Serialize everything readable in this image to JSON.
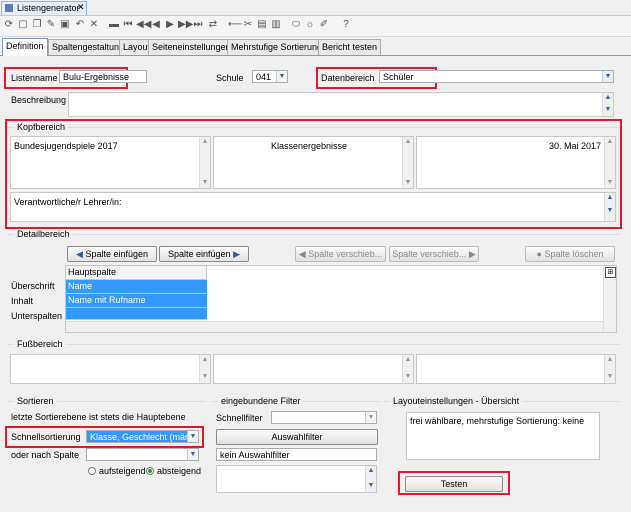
{
  "window": {
    "title": "Listengenerator"
  },
  "tabs": [
    {
      "label": "Definition"
    },
    {
      "label": "Spaltengestaltung"
    },
    {
      "label": "Layout"
    },
    {
      "label": "Seiteneinstellungen"
    },
    {
      "label": "Mehrstufige Sortierung"
    },
    {
      "label": "Bericht testen"
    }
  ],
  "header": {
    "listenname_label": "Listenname",
    "listenname_value": "Bulu-Ergebnisse",
    "schule_label": "Schule",
    "schule_value": "041",
    "datenbereich_label": "Datenbereich",
    "datenbereich_value": "Schüler",
    "beschreibung_label": "Beschreibung"
  },
  "kopfbereich": {
    "title": "Kopfbereich",
    "left": "Bundesjugendspiele 2017",
    "center": "Klassenergebnisse",
    "right": "30. Mai 2017",
    "bottom": "Verantwortliche/r Lehrer/in:"
  },
  "detailbereich": {
    "title": "Detailbereich",
    "btn_insert_left": "Spalte einfügen",
    "btn_insert_right": "Spalte einfügen",
    "btn_move_left": "Spalte verschieb...",
    "btn_move_right": "Spalte verschieb...",
    "btn_delete": "Spalte löschen",
    "row_labels": [
      "Überschrift",
      "Inhalt",
      "Unterspalten"
    ],
    "column_header": "Hauptspalte",
    "rows": [
      "Name",
      "Name mit Rufname"
    ]
  },
  "fussbereich": {
    "title": "Fußbereich"
  },
  "sortieren": {
    "title": "Sortieren",
    "note": "letzte Sortierebene ist stets die Hauptebene",
    "schnell_label": "Schnellsortierung",
    "schnell_value": "Klasse, Geschlecht (männlic",
    "oder_label": "oder nach Spalte",
    "oder_value": "",
    "asc_label": "aufsteigend",
    "desc_label": "absteigend"
  },
  "filter": {
    "title": "eingebundene Filter",
    "schnellfilter_label": "Schnellfilter",
    "schnellfilter_value": "",
    "auswahl_button": "Auswahlfilter",
    "auswahl_value": "kein Auswahlfilter"
  },
  "layout": {
    "title": "Layouteinstellungen - Übersicht",
    "text": "frei wählbare, mehrstufige Sortierung: keine"
  },
  "test_button": "Testen",
  "colors": {
    "highlight": "#3399ff",
    "red": "#e0192b"
  }
}
